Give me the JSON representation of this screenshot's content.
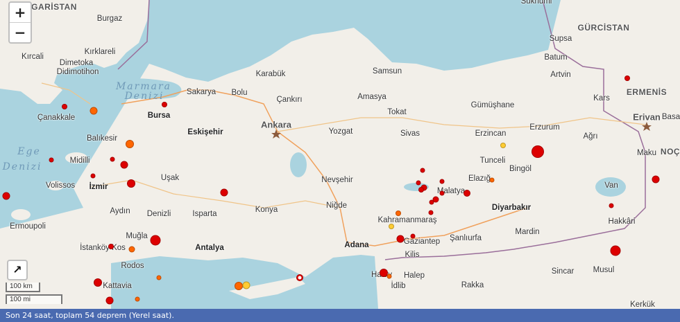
{
  "map": {
    "labels": [
      {
        "id": "garistan",
        "text": "GARİSTAN",
        "type": "country"
      },
      {
        "id": "gurcistan",
        "text": "GÜRCİSTAN",
        "type": "country"
      },
      {
        "id": "ermenis",
        "text": "ERMENİS",
        "type": "country"
      },
      {
        "id": "noc",
        "text": "NOÇ",
        "type": "country"
      },
      {
        "id": "marmara",
        "text": "Marmara",
        "type": "sea"
      },
      {
        "id": "denizi1",
        "text": "Denizi",
        "type": "sea"
      },
      {
        "id": "ege",
        "text": "Ege",
        "type": "sea"
      },
      {
        "id": "denizi2",
        "text": "Denizi",
        "type": "sea"
      },
      {
        "id": "ankara",
        "text": "Ankara",
        "type": "capital"
      },
      {
        "id": "erivan",
        "text": "Erivan",
        "type": "capital"
      },
      {
        "id": "sukhumi",
        "text": "Sukhumi",
        "type": "city"
      },
      {
        "id": "burgaz",
        "text": "Burgaz",
        "type": "city"
      },
      {
        "id": "supsa",
        "text": "Supsa",
        "type": "city"
      },
      {
        "id": "kircali",
        "text": "Kırcali",
        "type": "city"
      },
      {
        "id": "kirklareli",
        "text": "Kırklareli",
        "type": "city"
      },
      {
        "id": "dimetoka",
        "text": "Dimetoka",
        "type": "city"
      },
      {
        "id": "didimotihon",
        "text": "Didimotihon",
        "type": "city"
      },
      {
        "id": "batum",
        "text": "Batum",
        "type": "city"
      },
      {
        "id": "samsun",
        "text": "Samsun",
        "type": "city"
      },
      {
        "id": "karabuk",
        "text": "Karabük",
        "type": "city"
      },
      {
        "id": "artvin",
        "text": "Artvin",
        "type": "city"
      },
      {
        "id": "sakarya",
        "text": "Sakarya",
        "type": "city"
      },
      {
        "id": "bolu",
        "text": "Bolu",
        "type": "city"
      },
      {
        "id": "cankiri",
        "text": "Çankırı",
        "type": "city"
      },
      {
        "id": "amasya",
        "text": "Amasya",
        "type": "city"
      },
      {
        "id": "kars",
        "text": "Kars",
        "type": "city"
      },
      {
        "id": "gumushane",
        "text": "Gümüşhane",
        "type": "city"
      },
      {
        "id": "canakkale",
        "text": "Çanakkale",
        "type": "city"
      },
      {
        "id": "bursa",
        "text": "Bursa",
        "type": "bold"
      },
      {
        "id": "tokat",
        "text": "Tokat",
        "type": "city"
      },
      {
        "id": "eskisehir",
        "text": "Eskişehir",
        "type": "bold"
      },
      {
        "id": "yozgat",
        "text": "Yozgat",
        "type": "city"
      },
      {
        "id": "erzurum",
        "text": "Erzurum",
        "type": "city"
      },
      {
        "id": "sivas",
        "text": "Sivas",
        "type": "city"
      },
      {
        "id": "erzincan",
        "text": "Erzincan",
        "type": "city"
      },
      {
        "id": "agri",
        "text": "Ağrı",
        "type": "city"
      },
      {
        "id": "basa",
        "text": "Basa",
        "type": "city"
      },
      {
        "id": "balikesir",
        "text": "Balıkesir",
        "type": "city"
      },
      {
        "id": "tunceli",
        "text": "Tunceli",
        "type": "city"
      },
      {
        "id": "maku",
        "text": "Maku",
        "type": "city"
      },
      {
        "id": "midilli",
        "text": "Midilli",
        "type": "city"
      },
      {
        "id": "bingol",
        "text": "Bingöl",
        "type": "city"
      },
      {
        "id": "usak",
        "text": "Uşak",
        "type": "city"
      },
      {
        "id": "nevsehir",
        "text": "Nevşehir",
        "type": "city"
      },
      {
        "id": "elazig",
        "text": "Elazığ",
        "type": "city"
      },
      {
        "id": "volissos",
        "text": "Volissos",
        "type": "city"
      },
      {
        "id": "izmir",
        "text": "İzmir",
        "type": "bold"
      },
      {
        "id": "malatya",
        "text": "Malatya",
        "type": "city"
      },
      {
        "id": "van",
        "text": "Van",
        "type": "city"
      },
      {
        "id": "konya",
        "text": "Konya",
        "type": "city"
      },
      {
        "id": "nigde",
        "text": "Niğde",
        "type": "city"
      },
      {
        "id": "diyarbakir",
        "text": "Diyarbakır",
        "type": "bold"
      },
      {
        "id": "aydin",
        "text": "Aydın",
        "type": "city"
      },
      {
        "id": "denizli",
        "text": "Denizli",
        "type": "city"
      },
      {
        "id": "isparta",
        "text": "Isparta",
        "type": "city"
      },
      {
        "id": "ermoupoli",
        "text": "Ermoupoli",
        "type": "city"
      },
      {
        "id": "kahramanmaras",
        "text": "Kahramanmaraş",
        "type": "city"
      },
      {
        "id": "hakkari",
        "text": "Hakkâri",
        "type": "city"
      },
      {
        "id": "mardin",
        "text": "Mardin",
        "type": "city"
      },
      {
        "id": "mugla",
        "text": "Muğla",
        "type": "city"
      },
      {
        "id": "gaziantep",
        "text": "Gaziantep",
        "type": "city"
      },
      {
        "id": "sanliurfa",
        "text": "Şanlıurfa",
        "type": "city"
      },
      {
        "id": "antalya",
        "text": "Antalya",
        "type": "bold"
      },
      {
        "id": "adana",
        "text": "Adana",
        "type": "bold"
      },
      {
        "id": "istankoy",
        "text": "İstanköy Kos",
        "type": "city"
      },
      {
        "id": "kilis",
        "text": "Kilis",
        "type": "city"
      },
      {
        "id": "rodos",
        "text": "Rodos",
        "type": "city"
      },
      {
        "id": "sincar",
        "text": "Sincar",
        "type": "city"
      },
      {
        "id": "musul",
        "text": "Musul",
        "type": "city"
      },
      {
        "id": "hatay",
        "text": "Hatay",
        "type": "city"
      },
      {
        "id": "halep",
        "text": "Halep",
        "type": "city"
      },
      {
        "id": "kattavia",
        "text": "Kattavia",
        "type": "city"
      },
      {
        "id": "idlib",
        "text": "İdlib",
        "type": "city"
      },
      {
        "id": "rakka",
        "text": "Rakka",
        "type": "city"
      },
      {
        "id": "kerkuk",
        "text": "Kerkük",
        "type": "city"
      }
    ],
    "earthquake_colors": {
      "recent": "#dd0000",
      "hours": "#ff6600",
      "older": "#ffcc33"
    }
  },
  "controls": {
    "zoom_in": "+",
    "zoom_out": "−",
    "expand": "↗"
  },
  "scale": {
    "km": "100 km",
    "mi": "100 mi"
  },
  "footer": {
    "text": "Son 24 saat, toplam 54 deprem (Yerel saat)."
  }
}
